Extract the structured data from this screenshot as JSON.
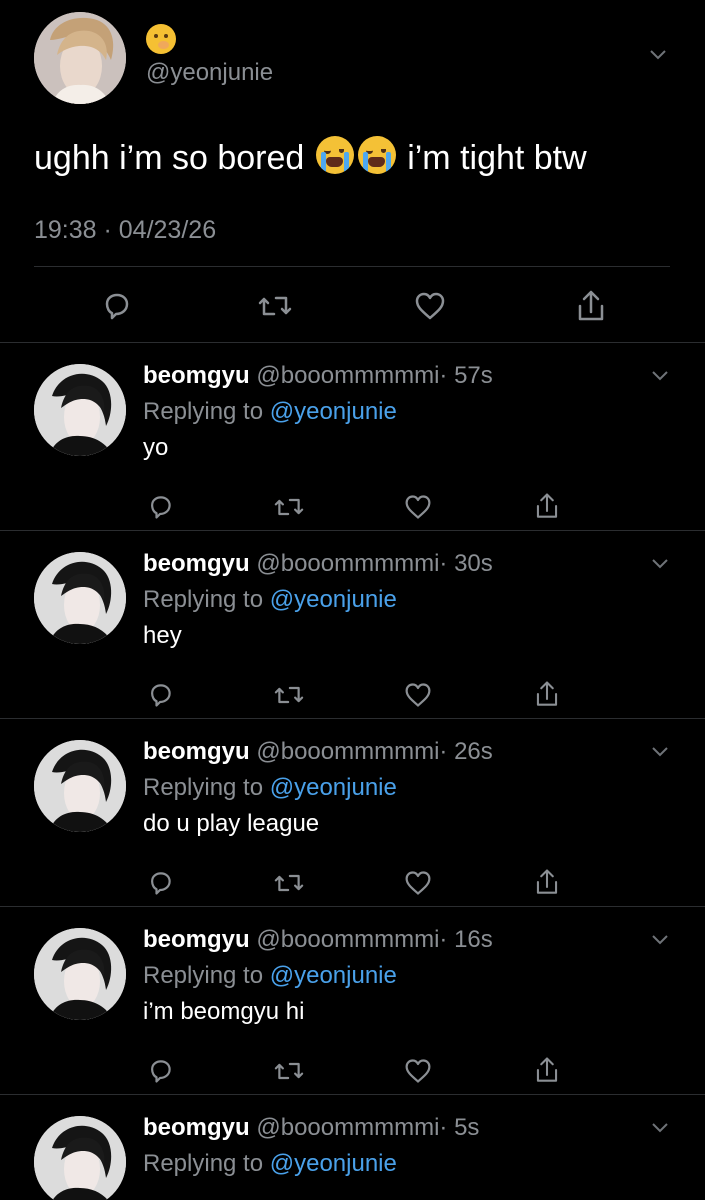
{
  "main_tweet": {
    "handle": "@yeonjunie",
    "text_prefix": "ughh i’m so bored",
    "text_suffix": "i’m tight btw",
    "meta": "19:38 · 04/23/26",
    "emoji": [
      "yawning-face",
      "loudly-crying-face",
      "loudly-crying-face"
    ]
  },
  "replies": [
    {
      "display_name": "beomgyu",
      "username": "@booommmmmi",
      "time": "· 57s",
      "replying_to": "Replying to ",
      "replying_handle": "@yeonjunie",
      "text": "yo"
    },
    {
      "display_name": "beomgyu",
      "username": "@booommmmmi",
      "time": "· 30s",
      "replying_to": "Replying to ",
      "replying_handle": "@yeonjunie",
      "text": "hey"
    },
    {
      "display_name": "beomgyu",
      "username": "@booommmmmi",
      "time": "· 26s",
      "replying_to": "Replying to ",
      "replying_handle": "@yeonjunie",
      "text": "do u play league"
    },
    {
      "display_name": "beomgyu",
      "username": "@booommmmmi",
      "time": "· 16s",
      "replying_to": "Replying to ",
      "replying_handle": "@yeonjunie",
      "text": "i’m beomgyu hi"
    },
    {
      "display_name": "beomgyu",
      "username": "@booommmmmi",
      "time": "· 5s",
      "replying_to": "Replying to ",
      "replying_handle": "@yeonjunie",
      "text": ""
    }
  ],
  "icons": {
    "reply": "reply-icon",
    "retweet": "retweet-icon",
    "like": "heart-icon",
    "share": "share-icon",
    "more": "chevron-down-icon"
  },
  "colors": {
    "background": "#000000",
    "primary_text": "#ffffff",
    "secondary_text": "#8b8f94",
    "link": "#4aa1ea",
    "divider": "#2b2d30"
  }
}
